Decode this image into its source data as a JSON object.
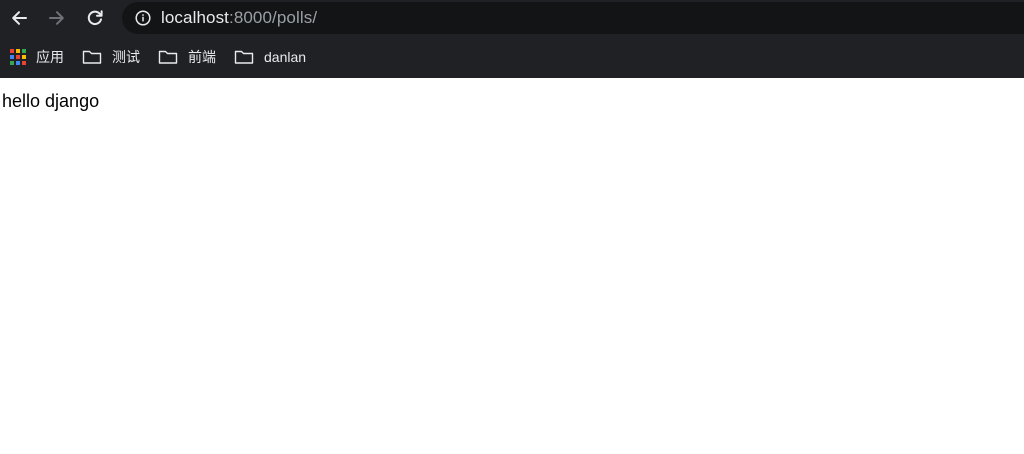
{
  "toolbar": {
    "back_icon": "arrow-left-icon",
    "forward_icon": "arrow-right-icon",
    "reload_icon": "reload-icon"
  },
  "address_bar": {
    "host": "localhost",
    "rest": ":8000/polls/",
    "security_icon": "info-icon"
  },
  "bookmarks": {
    "items": [
      {
        "label": "应用",
        "icon": "apps-grid-icon"
      },
      {
        "label": "测试",
        "icon": "folder-icon"
      },
      {
        "label": "前端",
        "icon": "folder-icon"
      },
      {
        "label": "danlan",
        "icon": "folder-icon"
      }
    ]
  },
  "page": {
    "body_text": "hello django"
  },
  "colors": {
    "chrome_bg": "#202124",
    "omnibox_bg": "#131415",
    "text_light": "#e8eaed",
    "text_dim": "#9aa0a6",
    "page_bg": "#ffffff"
  }
}
